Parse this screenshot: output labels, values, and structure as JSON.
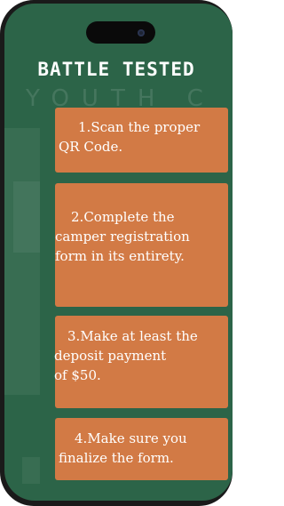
{
  "title": "BATTLE TESTED",
  "background_text": "YOUTH C",
  "steps": [
    {
      "number": "1.",
      "lines": [
        "Scan the proper",
        "QR Code."
      ]
    },
    {
      "number": "2.",
      "lines": [
        "Complete the",
        "camper registration",
        "form in its entirety."
      ]
    },
    {
      "number": "3.",
      "lines": [
        "Make at least the",
        "deposit payment",
        "of $50."
      ]
    },
    {
      "number": "4.",
      "lines": [
        "Make sure you",
        "finalize the form."
      ]
    }
  ],
  "colors": {
    "background": "#2c6448",
    "card": "#d27a45",
    "text": "#ffffff",
    "frame": "#1a1a1a"
  }
}
